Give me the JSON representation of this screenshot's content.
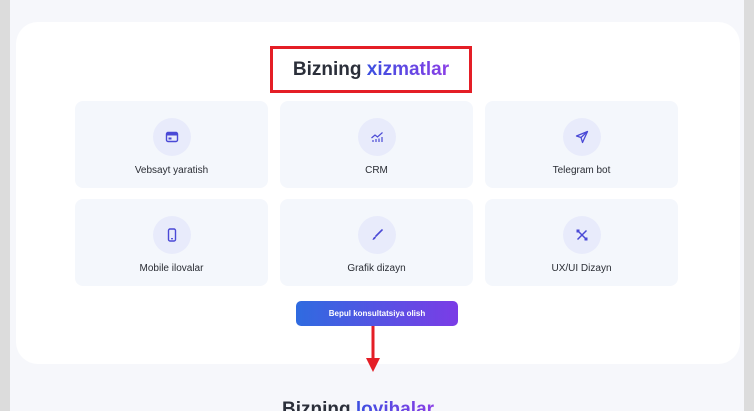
{
  "services_section": {
    "title_prefix": "Bizning",
    "title_highlight": "xizmatlar",
    "items": [
      {
        "label": "Vebsayt yaratish",
        "icon": "browser-window-icon"
      },
      {
        "label": "CRM",
        "icon": "chart-analytics-icon"
      },
      {
        "label": "Telegram bot",
        "icon": "paper-plane-icon"
      },
      {
        "label": "Mobile ilovalar",
        "icon": "mobile-phone-icon"
      },
      {
        "label": "Grafik dizayn",
        "icon": "brush-icon"
      },
      {
        "label": "UX/UI Dizayn",
        "icon": "design-tools-icon"
      }
    ],
    "cta_label": "Bepul konsultatsiya olish"
  },
  "next_section": {
    "title_prefix": "Bizning",
    "title_highlight": "loyihalar"
  },
  "colors": {
    "accent_gradient_start": "#3b4fe0",
    "accent_gradient_end": "#8a3fe6",
    "annotation_red": "#e41e26",
    "icon_bg": "#e8ebfb",
    "card_bg": "#f4f7fc"
  }
}
